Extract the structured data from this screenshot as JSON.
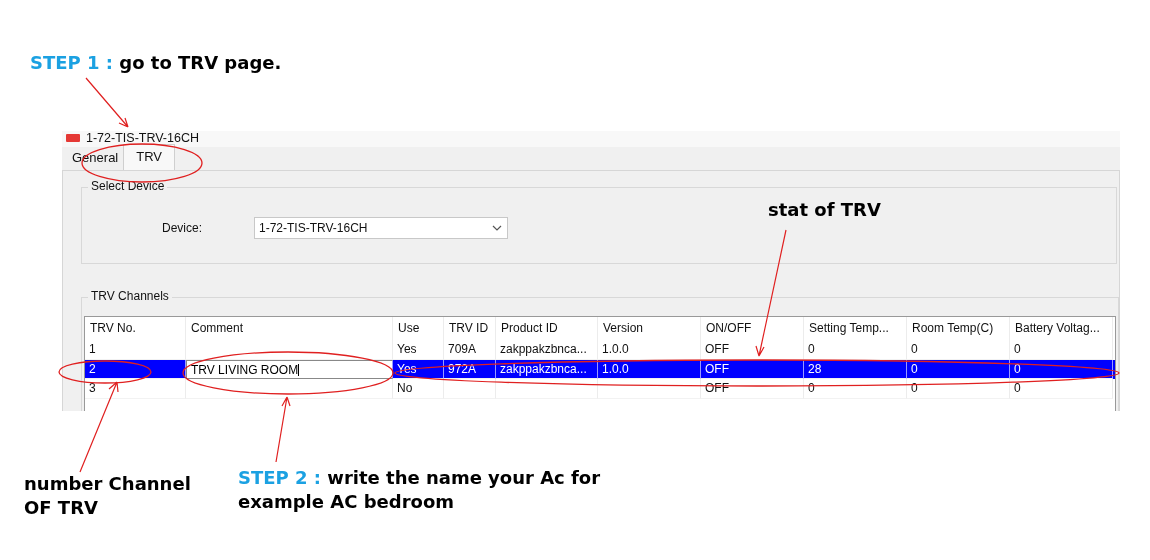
{
  "step1": {
    "step": "STEP 1 :",
    "text": "go to TRV page."
  },
  "window": {
    "title": "1-72-TIS-TRV-16CH"
  },
  "tabs": [
    {
      "label": "General",
      "selected": false
    },
    {
      "label": "TRV",
      "selected": true
    }
  ],
  "select_device": {
    "title": "Select Device",
    "label": "Device:",
    "value": "1-72-TIS-TRV-16CH"
  },
  "channels": {
    "title": "TRV Channels",
    "columns": [
      "TRV No.",
      "Comment",
      "Use",
      "TRV ID",
      "Product ID",
      "Version",
      "ON/OFF",
      "Setting Temp...",
      "Room Temp(C)",
      "Battery Voltag..."
    ],
    "rows": [
      {
        "selected": false,
        "editing": false,
        "cells": [
          "1",
          "",
          "Yes",
          "709A",
          "zakppakzbnca...",
          "1.0.0",
          "OFF",
          "0",
          "0",
          "0"
        ]
      },
      {
        "selected": true,
        "editing": true,
        "cells": [
          "2",
          "TRV LIVING ROOM",
          "Yes",
          "972A",
          "zakppakzbnca...",
          "1.0.0",
          "OFF",
          "28",
          "0",
          "0"
        ]
      },
      {
        "selected": false,
        "editing": false,
        "cells": [
          "3",
          "",
          "No",
          "",
          "",
          "",
          "OFF",
          "0",
          "0",
          "0"
        ]
      }
    ]
  },
  "notes": {
    "stat": "stat of TRV",
    "channel": "number Channel\nOF TRV",
    "step2": {
      "step": "STEP 2 :",
      "text": "write the name your Ac for\nexample AC bedroom"
    }
  }
}
